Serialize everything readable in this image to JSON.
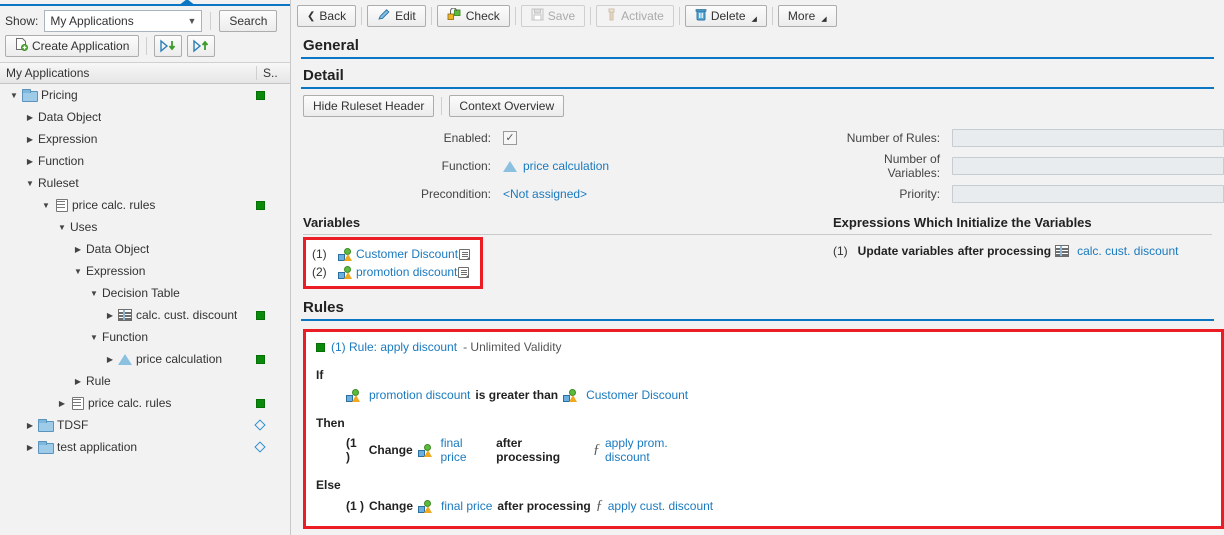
{
  "left": {
    "show_label": "Show:",
    "filter_value": "My Applications",
    "search_button": "Search",
    "create_button": "Create Application",
    "expand_all_title": "Expand All",
    "collapse_all_title": "Collapse All",
    "tree_header_main": "My Applications",
    "tree_header_status": "S..",
    "tree": [
      {
        "label": "Pricing",
        "indent": 0,
        "twisty": "down",
        "icon": "folder",
        "status": "green"
      },
      {
        "label": "Data Object",
        "indent": 1,
        "twisty": "right",
        "icon": "none",
        "status": "none"
      },
      {
        "label": "Expression",
        "indent": 1,
        "twisty": "right",
        "icon": "none",
        "status": "none"
      },
      {
        "label": "Function",
        "indent": 1,
        "twisty": "right",
        "icon": "none",
        "status": "none"
      },
      {
        "label": "Ruleset",
        "indent": 1,
        "twisty": "down",
        "icon": "none",
        "status": "none"
      },
      {
        "label": "price calc. rules",
        "indent": 2,
        "twisty": "down",
        "icon": "ruleset",
        "status": "green"
      },
      {
        "label": "Uses",
        "indent": 3,
        "twisty": "down",
        "icon": "none",
        "status": "none"
      },
      {
        "label": "Data Object",
        "indent": 4,
        "twisty": "right",
        "icon": "none",
        "status": "none"
      },
      {
        "label": "Expression",
        "indent": 4,
        "twisty": "down",
        "icon": "none",
        "status": "none"
      },
      {
        "label": "Decision Table",
        "indent": 5,
        "twisty": "down",
        "icon": "none",
        "status": "none"
      },
      {
        "label": "calc. cust. discount",
        "indent": 6,
        "twisty": "right",
        "icon": "decision-table",
        "status": "green"
      },
      {
        "label": "Function",
        "indent": 5,
        "twisty": "down",
        "icon": "none",
        "status": "none"
      },
      {
        "label": "price calculation",
        "indent": 6,
        "twisty": "right",
        "icon": "triangle",
        "status": "green"
      },
      {
        "label": "Rule",
        "indent": 4,
        "twisty": "right",
        "icon": "none",
        "status": "none"
      },
      {
        "label": "price calc. rules",
        "indent": 3,
        "twisty": "right",
        "icon": "ruleset",
        "status": "green"
      },
      {
        "label": "TDSF",
        "indent": 1,
        "twisty": "right",
        "icon": "folder",
        "status": "diamond"
      },
      {
        "label": "test application",
        "indent": 1,
        "twisty": "right",
        "icon": "folder",
        "status": "diamond"
      }
    ]
  },
  "toolbar": {
    "back": "Back",
    "edit": "Edit",
    "check": "Check",
    "save": "Save",
    "activate": "Activate",
    "delete": "Delete",
    "more": "More"
  },
  "general": {
    "title": "General"
  },
  "detail": {
    "title": "Detail",
    "hide_header_button": "Hide Ruleset Header",
    "context_overview_button": "Context Overview",
    "enabled_label": "Enabled:",
    "enabled_checked": "✓",
    "function_label": "Function:",
    "function_value": "price calculation",
    "precondition_label": "Precondition:",
    "precondition_value": "<Not assigned>",
    "number_of_rules_label": "Number of Rules:",
    "number_of_rules_value": "",
    "number_of_variables_label": "Number of Variables:",
    "number_of_variables_value": "",
    "priority_label": "Priority:",
    "priority_value": ""
  },
  "variables": {
    "title": "Variables",
    "items": [
      {
        "num": "(1)",
        "name": "Customer Discount"
      },
      {
        "num": "(2)",
        "name": "promotion discount"
      }
    ]
  },
  "expressions": {
    "title": "Expressions Which Initialize the Variables",
    "items": [
      {
        "num": "(1)",
        "action": "Update variables",
        "connector": "after processing",
        "target": "calc. cust. discount"
      }
    ]
  },
  "rules": {
    "title": "Rules",
    "rule_link": "(1) Rule: apply discount",
    "validity": "- Unlimited Validity",
    "if_keyword": "If",
    "if_left": "promotion discount",
    "if_operator": "is greater than",
    "if_right": "Customer Discount",
    "then_keyword": "Then",
    "then_num": "(1 )",
    "then_verb": "Change",
    "then_target": "final price",
    "then_connector": "after processing",
    "then_function": "apply prom. discount",
    "else_keyword": "Else",
    "else_num": "(1 )",
    "else_verb": "Change",
    "else_target": "final price",
    "else_connector": "after processing",
    "else_function": "apply cust. discount"
  },
  "colors": {
    "accent_blue": "#0a76c4",
    "link_blue": "#1a7abf",
    "status_green": "#0a8a0a",
    "highlight_red": "#ec1c24",
    "diamond_blue": "#2f8fd0"
  }
}
